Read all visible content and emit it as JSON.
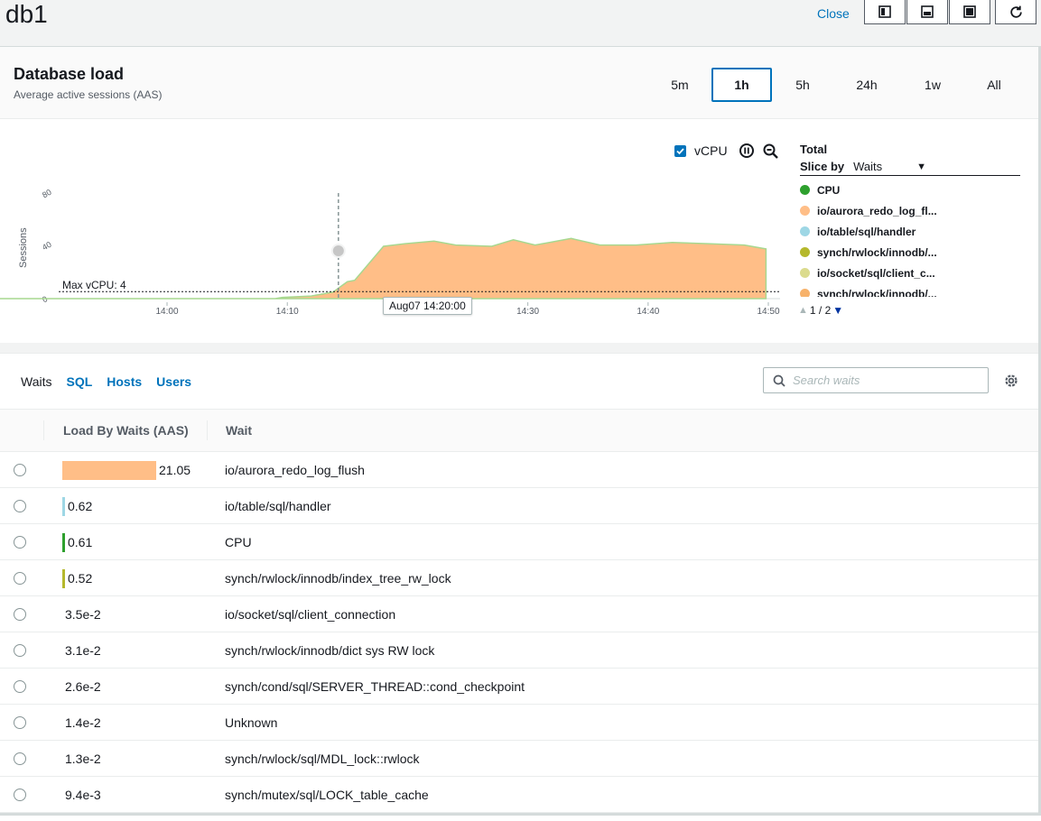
{
  "header": {
    "title": "db1",
    "close_label": "Close"
  },
  "layout_icons": [
    "layout-left-icon",
    "layout-bottom-icon",
    "layout-full-icon",
    "refresh-icon"
  ],
  "panel": {
    "title": "Database load",
    "subtitle": "Average active sessions (AAS)",
    "ranges": [
      "5m",
      "1h",
      "5h",
      "24h",
      "1w",
      "All"
    ],
    "active_range": "1h"
  },
  "chart_controls": {
    "vcpu_label": "vCPU",
    "vcpu_checked": true
  },
  "chart_data": {
    "type": "area",
    "ylabel": "Sessions",
    "yticks": [
      "0",
      "40",
      "80"
    ],
    "ylim": [
      0,
      100
    ],
    "xticks": [
      "14:00",
      "14:10",
      "14:20",
      "14:30",
      "14:40",
      "14:50"
    ],
    "max_vcpu_label": "Max vCPU: 4",
    "max_vcpu": 4,
    "tooltip": "Aug07 14:20:00",
    "series": [
      {
        "name": "io/aurora_redo_log_flush",
        "color": "#ffbe87",
        "x": [
          13.6,
          14.05,
          14.15,
          14.16,
          14.2,
          14.23,
          14.25,
          14.26,
          14.3,
          14.33,
          14.37,
          14.4,
          14.45,
          14.48,
          14.51,
          14.53,
          14.56,
          14.6,
          14.65,
          14.7,
          14.75,
          14.8,
          14.83
        ],
        "y": [
          0,
          0,
          0,
          1,
          2,
          5,
          13,
          14,
          40,
          42,
          44,
          41,
          40,
          45,
          41,
          43,
          46,
          41,
          41,
          43,
          42,
          41,
          38
        ]
      }
    ],
    "chart_rect": {}
  },
  "legend": {
    "total_label": "Total",
    "slice_label": "Slice by",
    "slice_value": "Waits",
    "items": [
      {
        "label": "CPU",
        "color": "#2ea02e"
      },
      {
        "label": "io/aurora_redo_log_fl...",
        "color": "#ffbe87"
      },
      {
        "label": "io/table/sql/handler",
        "color": "#9ed7e5"
      },
      {
        "label": "synch/rwlock/innodb/...",
        "color": "#b5b82c"
      },
      {
        "label": "io/socket/sql/client_c...",
        "color": "#dbdb8d"
      },
      {
        "label": "synch/rwlock/innodb/...",
        "color": "#f7b26b"
      }
    ],
    "page": "1 / 2"
  },
  "tabs": [
    "Waits",
    "SQL",
    "Hosts",
    "Users"
  ],
  "search": {
    "placeholder": "Search waits"
  },
  "table": {
    "headers": [
      "Load By Waits (AAS)",
      "Wait"
    ],
    "rows": [
      {
        "value": "21.05",
        "amount": 21.05,
        "wait": "io/aurora_redo_log_flush",
        "color": "#ffbe87"
      },
      {
        "value": "0.62",
        "amount": 0.62,
        "wait": "io/table/sql/handler",
        "color": "#9ed7e5"
      },
      {
        "value": "0.61",
        "amount": 0.61,
        "wait": "CPU",
        "color": "#2ea02e"
      },
      {
        "value": "0.52",
        "amount": 0.52,
        "wait": "synch/rwlock/innodb/index_tree_rw_lock",
        "color": "#b5b82c"
      },
      {
        "value": "3.5e-2",
        "amount": 0.035,
        "wait": "io/socket/sql/client_connection",
        "color": "#dbdb8d"
      },
      {
        "value": "3.1e-2",
        "amount": 0.031,
        "wait": "synch/rwlock/innodb/dict sys RW lock",
        "color": "#f7b26b"
      },
      {
        "value": "2.6e-2",
        "amount": 0.026,
        "wait": "synch/cond/sql/SERVER_THREAD::cond_checkpoint",
        "color": "#c5b0d5"
      },
      {
        "value": "1.4e-2",
        "amount": 0.014,
        "wait": "Unknown",
        "color": "#aec7e8"
      },
      {
        "value": "1.3e-2",
        "amount": 0.013,
        "wait": "synch/rwlock/sql/MDL_lock::rwlock",
        "color": "#ff9896"
      },
      {
        "value": "9.4e-3",
        "amount": 0.0094,
        "wait": "synch/mutex/sql/LOCK_table_cache",
        "color": "#98df8a"
      }
    ]
  }
}
